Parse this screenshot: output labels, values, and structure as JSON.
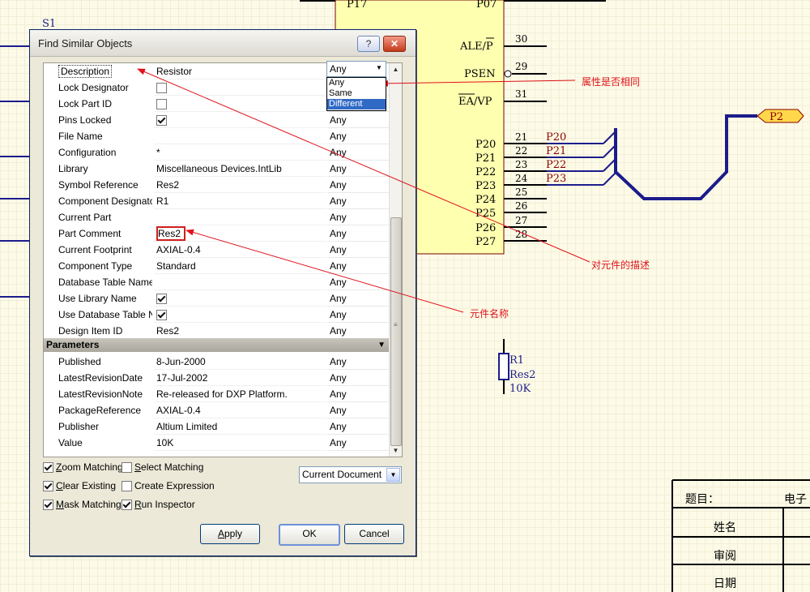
{
  "dialog": {
    "title": "Find Similar Objects",
    "help_icon": "?",
    "close_icon": "✕"
  },
  "property_rows": [
    {
      "name": "Description",
      "value": "Resistor",
      "match": "Any"
    },
    {
      "name": "Lock Designator",
      "check": false,
      "match": "Any"
    },
    {
      "name": "Lock Part ID",
      "check": false,
      "match": "Any"
    },
    {
      "name": "Pins Locked",
      "check": true,
      "match": "Any"
    },
    {
      "name": "File Name",
      "value": "",
      "match": "Any"
    },
    {
      "name": "Configuration",
      "value": "*",
      "match": "Any"
    },
    {
      "name": "Library",
      "value": "Miscellaneous Devices.IntLib",
      "match": "Any"
    },
    {
      "name": "Symbol Reference",
      "value": "Res2",
      "match": "Any"
    },
    {
      "name": "Component Designator",
      "value": "R1",
      "match": "Any"
    },
    {
      "name": "Current Part",
      "value": "",
      "match": "Any"
    },
    {
      "name": "Part Comment",
      "value": "Res2",
      "match": "Any"
    },
    {
      "name": "Current Footprint",
      "value": "AXIAL-0.4",
      "match": "Any"
    },
    {
      "name": "Component Type",
      "value": "Standard",
      "match": "Any"
    },
    {
      "name": "Database Table Name",
      "value": "",
      "match": "Any"
    },
    {
      "name": "Use Library Name",
      "check": true,
      "match": "Any"
    },
    {
      "name": "Use Database Table Na",
      "check": true,
      "match": "Any"
    },
    {
      "name": "Design Item ID",
      "value": "Res2",
      "match": "Any"
    }
  ],
  "parameters_header": "Parameters",
  "parameter_rows": [
    {
      "name": "Published",
      "value": "8-Jun-2000",
      "match": "Any"
    },
    {
      "name": "LatestRevisionDate",
      "value": "17-Jul-2002",
      "match": "Any"
    },
    {
      "name": "LatestRevisionNote",
      "value": "Re-released for DXP Platform.",
      "match": "Any"
    },
    {
      "name": "PackageReference",
      "value": "AXIAL-0.4",
      "match": "Any"
    },
    {
      "name": "Publisher",
      "value": "Altium Limited",
      "match": "Any"
    },
    {
      "name": "Value",
      "value": "10K",
      "match": "Any"
    }
  ],
  "match_dropdown": {
    "selected": "Any",
    "options": [
      "Any",
      "Same",
      "Different"
    ],
    "highlighted": "Different"
  },
  "options": {
    "zoom_matching": {
      "u": "Z",
      "rest": "oom Matching",
      "checked": true
    },
    "select_matching": {
      "u": "S",
      "rest": "elect Matching",
      "checked": false
    },
    "clear_existing": {
      "u": "C",
      "rest": "lear Existing",
      "checked": true
    },
    "create_expression": {
      "u": "",
      "rest": "Create Expression",
      "checked": false
    },
    "mask_matching": {
      "u": "M",
      "rest": "ask Matching",
      "checked": true
    },
    "run_inspector": {
      "u": "R",
      "rest": "un Inspector",
      "checked": true
    }
  },
  "scope": {
    "selected": "Current Document"
  },
  "buttons": {
    "apply_u": "A",
    "apply_rest": "pply",
    "ok": "OK",
    "cancel": "Cancel"
  },
  "annotations": {
    "match_note": "属性是否相同",
    "description_note": "对元件的描述",
    "name_note": "元件名称"
  },
  "schematic": {
    "s1": "S1",
    "pins_top": [
      "P17",
      "P07"
    ],
    "pins_right": [
      {
        "label": "ALE/P",
        "num": "30"
      },
      {
        "label": "PSEN",
        "num": "29"
      },
      {
        "label": "EA/VP",
        "num": "31"
      }
    ],
    "port_pins": [
      {
        "label": "P20",
        "num": "21",
        "net": "P20"
      },
      {
        "label": "P21",
        "num": "22",
        "net": "P21"
      },
      {
        "label": "P22",
        "num": "23",
        "net": "P22"
      },
      {
        "label": "P23",
        "num": "24",
        "net": "P23"
      },
      {
        "label": "P24",
        "num": "25",
        "net": ""
      },
      {
        "label": "P25",
        "num": "26",
        "net": ""
      },
      {
        "label": "P26",
        "num": "27",
        "net": ""
      },
      {
        "label": "P27",
        "num": "28",
        "net": ""
      }
    ],
    "port_label": "P2",
    "resistor": {
      "designator": "R1",
      "comment": "Res2",
      "value": "10K"
    },
    "title_block": {
      "title_label": "题目：",
      "title_value": "电子",
      "name_label": "姓名",
      "review_label": "审阅",
      "date_label": "日期"
    }
  },
  "colors": {
    "annotation": "#e0111b",
    "chip_fill": "#ffffb0",
    "bus": "#1c1c8c",
    "net_label": "#8b0000"
  }
}
